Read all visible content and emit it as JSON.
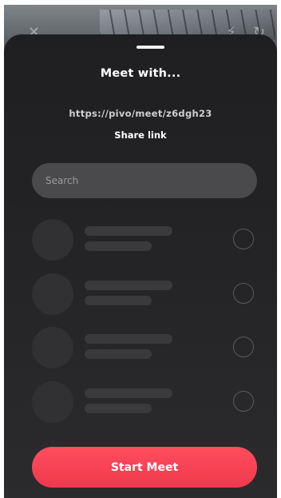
{
  "camera": {
    "close_icon": "close-icon",
    "flash_icon": "flash-icon",
    "rotate_icon": "rotate-camera-icon"
  },
  "sheet": {
    "title": "Meet with...",
    "meet_link": "https://pivo/meet/z6dgh23",
    "share_label": "Share link",
    "search": {
      "placeholder": "Search",
      "value": ""
    },
    "start_label": "Start Meet"
  },
  "colors": {
    "sheet_background": "#232325",
    "search_background": "#4a4a4d",
    "accent": "#f0394c",
    "skeleton": "#3a3a3d"
  }
}
